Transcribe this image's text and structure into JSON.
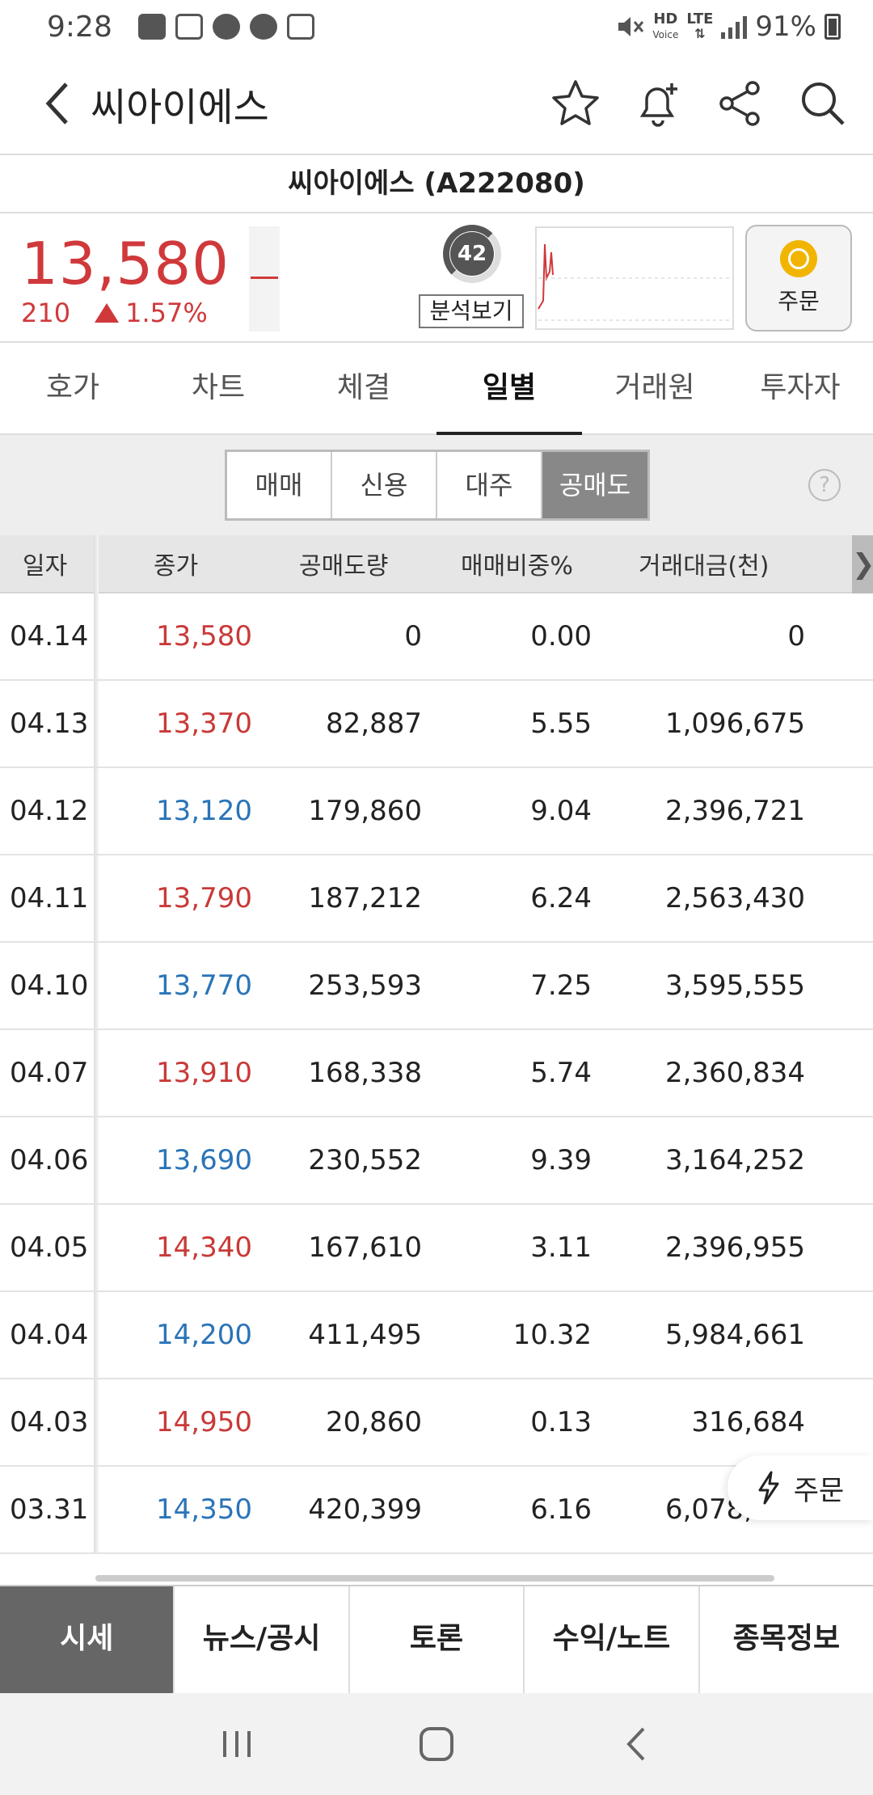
{
  "status_bar": {
    "time": "9:28",
    "battery": "91%",
    "hd_label": "HD",
    "voice_label": "Voice",
    "lte_label": "LTE"
  },
  "app_bar": {
    "title": "씨아이에스"
  },
  "stock": {
    "name_code": "씨아이에스 (A222080)",
    "price": "13,580",
    "change": "210",
    "change_pct": "1.57%",
    "score": "42",
    "analysis_label": "분석보기",
    "order_label": "주문"
  },
  "tabs": [
    "호가",
    "차트",
    "체결",
    "일별",
    "거래원",
    "투자자"
  ],
  "active_tab": "일별",
  "segments": [
    "매매",
    "신용",
    "대주",
    "공매도"
  ],
  "active_segment": "공매도",
  "help_label": "?",
  "table": {
    "headers": [
      "일자",
      "종가",
      "공매도량",
      "매매비중%",
      "거래대금(천)"
    ],
    "rows": [
      {
        "date": "04.14",
        "close": "13,580",
        "dir": "up",
        "short_vol": "0",
        "ratio": "0.00",
        "amount": "0"
      },
      {
        "date": "04.13",
        "close": "13,370",
        "dir": "up",
        "short_vol": "82,887",
        "ratio": "5.55",
        "amount": "1,096,675"
      },
      {
        "date": "04.12",
        "close": "13,120",
        "dir": "down",
        "short_vol": "179,860",
        "ratio": "9.04",
        "amount": "2,396,721"
      },
      {
        "date": "04.11",
        "close": "13,790",
        "dir": "up",
        "short_vol": "187,212",
        "ratio": "6.24",
        "amount": "2,563,430"
      },
      {
        "date": "04.10",
        "close": "13,770",
        "dir": "down",
        "short_vol": "253,593",
        "ratio": "7.25",
        "amount": "3,595,555"
      },
      {
        "date": "04.07",
        "close": "13,910",
        "dir": "up",
        "short_vol": "168,338",
        "ratio": "5.74",
        "amount": "2,360,834"
      },
      {
        "date": "04.06",
        "close": "13,690",
        "dir": "down",
        "short_vol": "230,552",
        "ratio": "9.39",
        "amount": "3,164,252"
      },
      {
        "date": "04.05",
        "close": "14,340",
        "dir": "up",
        "short_vol": "167,610",
        "ratio": "3.11",
        "amount": "2,396,955"
      },
      {
        "date": "04.04",
        "close": "14,200",
        "dir": "down",
        "short_vol": "411,495",
        "ratio": "10.32",
        "amount": "5,984,661"
      },
      {
        "date": "04.03",
        "close": "14,950",
        "dir": "up",
        "short_vol": "20,860",
        "ratio": "0.13",
        "amount": "316,684"
      },
      {
        "date": "03.31",
        "close": "14,350",
        "dir": "down",
        "short_vol": "420,399",
        "ratio": "6.16",
        "amount": "6,078,625"
      }
    ]
  },
  "float_order_label": "주문",
  "bottom_nav": [
    "시세",
    "뉴스/공시",
    "토론",
    "수익/노트",
    "종목정보"
  ],
  "active_bottom": "시세",
  "colors": {
    "up": "#c83a38",
    "down": "#2a74b8",
    "order_medal": "#f1b500"
  }
}
